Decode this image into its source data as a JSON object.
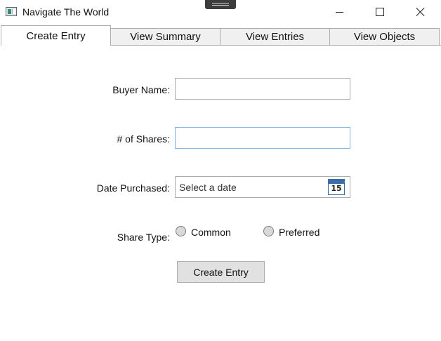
{
  "window": {
    "title": "Navigate The World",
    "icons": {
      "app": "app-window-icon",
      "minimize": "minimize-icon",
      "maximize": "maximize-icon",
      "close": "close-icon"
    }
  },
  "tabs": [
    {
      "label": "Create Entry",
      "selected": true
    },
    {
      "label": "View Summary",
      "selected": false
    },
    {
      "label": "View Entries",
      "selected": false
    },
    {
      "label": "View Objects",
      "selected": false
    }
  ],
  "form": {
    "buyer_name": {
      "label": "Buyer Name:",
      "value": ""
    },
    "shares": {
      "label": "# of Shares:",
      "value": ""
    },
    "date_purchased": {
      "label": "Date Purchased:",
      "placeholder": "Select a date",
      "calendar_day": "15"
    },
    "share_type": {
      "label": "Share Type:",
      "options": [
        {
          "label": "Common",
          "checked": false
        },
        {
          "label": "Preferred",
          "checked": false
        }
      ]
    },
    "submit_label": "Create Entry"
  }
}
